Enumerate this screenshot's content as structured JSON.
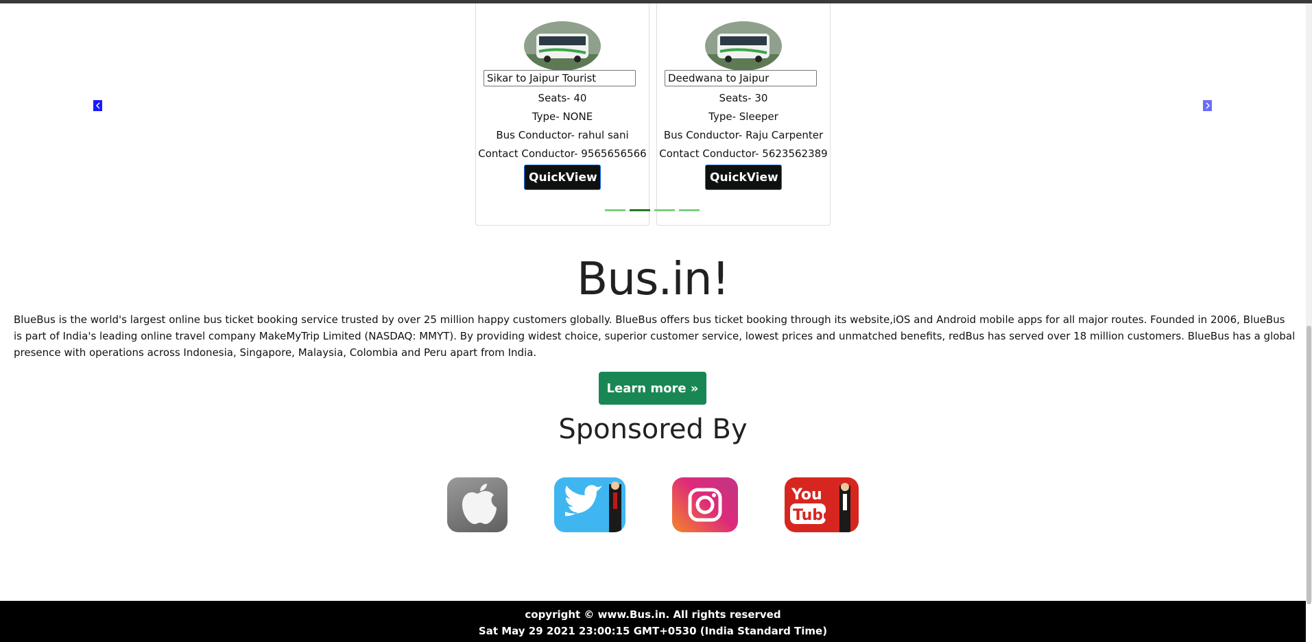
{
  "carousel": {
    "prev_icon": "chevron-left-icon",
    "next_icon": "chevron-right-icon",
    "indicator_count": 4,
    "active_indicator": 2,
    "cards": [
      {
        "route": "Sikar to Jaipur Tourist",
        "seats": "Seats- 40",
        "type": "Type- NONE",
        "conductor": "Bus Conductor- rahul sani",
        "contact": "Contact Conductor- 9565656566",
        "button": "QuickView",
        "image": "bus-image"
      },
      {
        "route": "Deedwana to Jaipur",
        "seats": "Seats- 30",
        "type": "Type- Sleeper",
        "conductor": "Bus Conductor- Raju Carpenter",
        "contact": "Contact Conductor- 5623562389",
        "button": "QuickView",
        "image": "bus-image"
      }
    ]
  },
  "about": {
    "title": "Bus.in!",
    "text": "BlueBus is the world's largest online bus ticket booking service trusted by over 25 million happy customers globally. BlueBus offers bus ticket booking through its website,iOS and Android mobile apps for all major routes. Founded in 2006, BlueBus is part of India's leading online travel company MakeMyTrip Limited (NASDAQ: MMYT). By providing widest choice, superior customer service, lowest prices and unmatched benefits, redBus has served over 18 million customers. BlueBus has a global presence with operations across Indonesia, Singapore, Malaysia, Colombia and Peru apart from India.",
    "button": "Learn more »"
  },
  "sponsors": {
    "title": "Sponsored By",
    "items": [
      "apple-logo",
      "twitter-logo",
      "instagram-logo",
      "youtube-logo"
    ]
  },
  "footer": {
    "copyright": "copyright © www.Bus.in. All rights reserved",
    "datetime": "Sat May 29 2021 23:00:15 GMT+0530 (India Standard Time)"
  },
  "colors": {
    "quickview_bg": "#0f1111",
    "learn_more_bg": "#198754",
    "indicator": "#7ccf7c",
    "indicator_active": "#1e7a1e",
    "footer_bg": "#000000"
  }
}
